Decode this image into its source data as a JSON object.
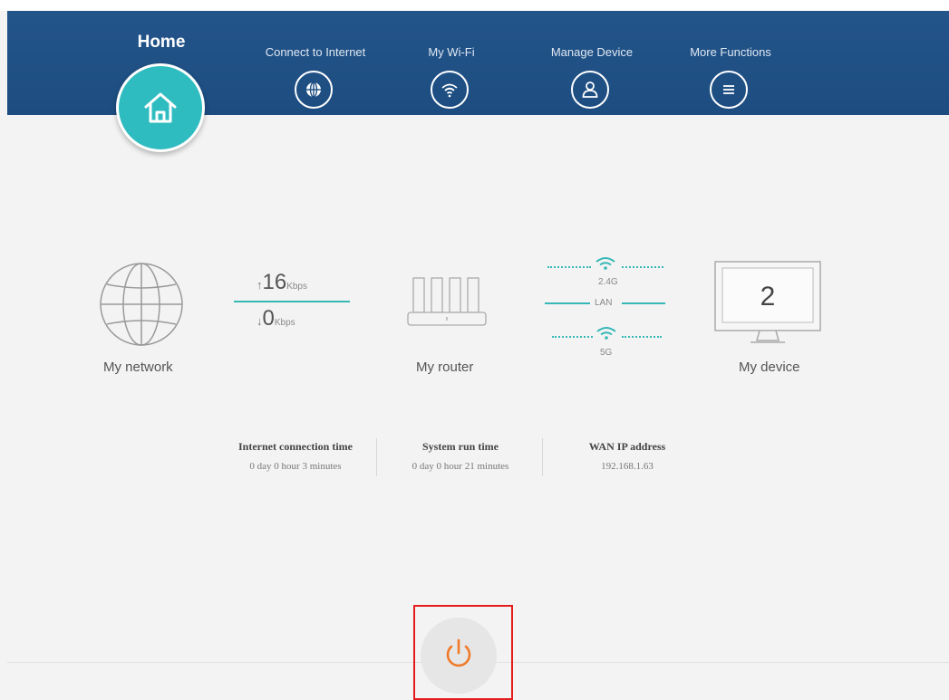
{
  "nav": {
    "home": "Home",
    "items": [
      {
        "label": "Connect to Internet",
        "icon": "globe-icon"
      },
      {
        "label": "My Wi-Fi",
        "icon": "wifi-icon"
      },
      {
        "label": "Manage Device",
        "icon": "user-icon"
      },
      {
        "label": "More Functions",
        "icon": "menu-icon"
      }
    ]
  },
  "status": {
    "network_label": "My network",
    "upload": {
      "value": "16",
      "unit": "Kbps"
    },
    "download": {
      "value": "0",
      "unit": "Kbps"
    },
    "router_label": "My router",
    "bands": {
      "band1": "2.4G",
      "lan": "LAN",
      "band2": "5G"
    },
    "device_count": "2",
    "device_label": "My device"
  },
  "stats": [
    {
      "title": "Internet connection time",
      "value": "0 day 0 hour 3 minutes"
    },
    {
      "title": "System run time",
      "value": "0 day 0 hour 21 minutes"
    },
    {
      "title": "WAN IP address",
      "value": "192.168.1.63"
    }
  ],
  "colors": {
    "nav_bg": "#1d4d80",
    "accent": "#2fbcc0",
    "power": "#f07a2a",
    "highlight": "#e51c1c"
  }
}
